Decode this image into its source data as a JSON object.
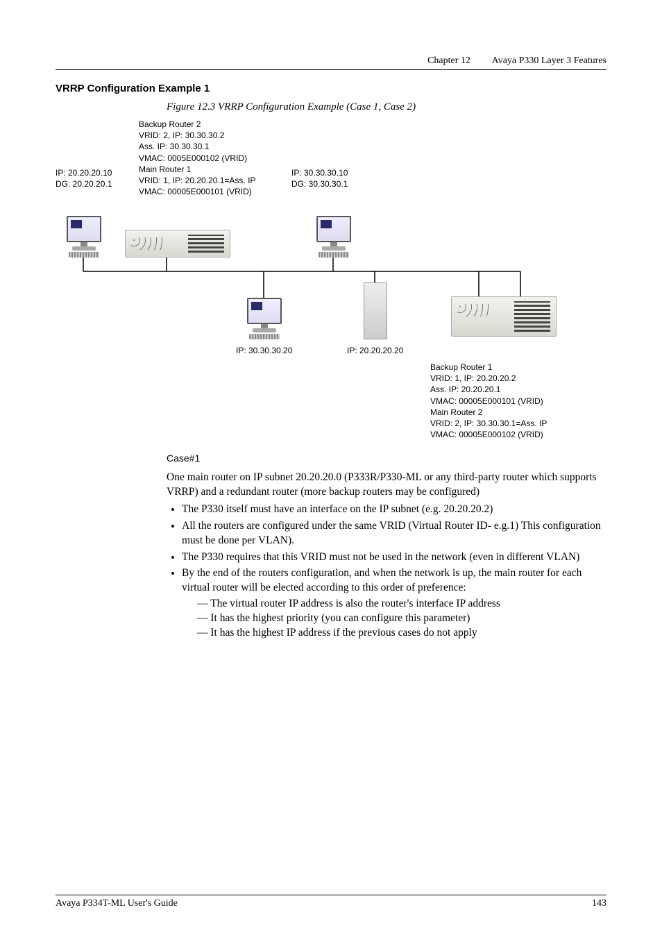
{
  "header": {
    "chapter": "Chapter 12",
    "title": "Avaya P330 Layer 3 Features"
  },
  "section_title": "VRRP Configuration Example 1",
  "figure_caption": "Figure 12.3    VRRP Configuration Example (Case 1, Case 2)",
  "diagram": {
    "left_host": {
      "ip": "IP: 20.20.20.10",
      "dg": "DG: 20.20.20.1"
    },
    "left_router_block": {
      "l1": "Backup Router 2",
      "l2": "VRID: 2, IP: 30.30.30.2",
      "l3": "Ass. IP: 30.30.30.1",
      "l4": "VMAC: 0005E000102 (VRID)",
      "l5": "Main Router 1",
      "l6": "VRID: 1, IP: 20.20.20.1=Ass. IP",
      "l7": "VMAC: 00005E000101 (VRID)"
    },
    "right_host": {
      "ip": "IP: 30.30.30.10",
      "dg": "DG: 30.30.30.1"
    },
    "mid_left_ip": "IP: 30.30.30.20",
    "mid_right_ip": "IP: 20.20.20.20",
    "right_router_block": {
      "l1": "Backup Router 1",
      "l2": "VRID: 1, IP: 20.20.20.2",
      "l3": "Ass. IP: 20.20.20.1",
      "l4": "VMAC: 00005E000101 (VRID)",
      "l5": "Main Router 2",
      "l6": "VRID: 2, IP: 30.30.30.1=Ass. IP",
      "l7": "VMAC: 00005E000102 (VRID)"
    }
  },
  "body": {
    "case_heading": "Case#1",
    "intro": "One main router on IP subnet 20.20.20.0 (P333R/P330-ML or any third-party router which supports VRRP) and a redundant router (more backup routers may be configured)",
    "bullets": {
      "b1": "The P330 itself must have an interface on the IP subnet (e.g. 20.20.20.2)",
      "b2": "All the routers are configured under the same VRID (Virtual Router ID- e.g.1) This configuration must be done per VLAN).",
      "b3": "The P330 requires that this VRID must not be used in the network (even in different VLAN)",
      "b4": "By the end of the routers configuration, and when the network is up, the main router for each virtual router will be elected according to this order of preference:",
      "d1": "The virtual router IP address is also the router's interface IP address",
      "d2": "It has the highest priority (you can configure this parameter)",
      "d3": "It has the highest IP address if the previous cases do not apply"
    }
  },
  "footer": {
    "left": "Avaya P334T-ML User's Guide",
    "right": "143"
  }
}
